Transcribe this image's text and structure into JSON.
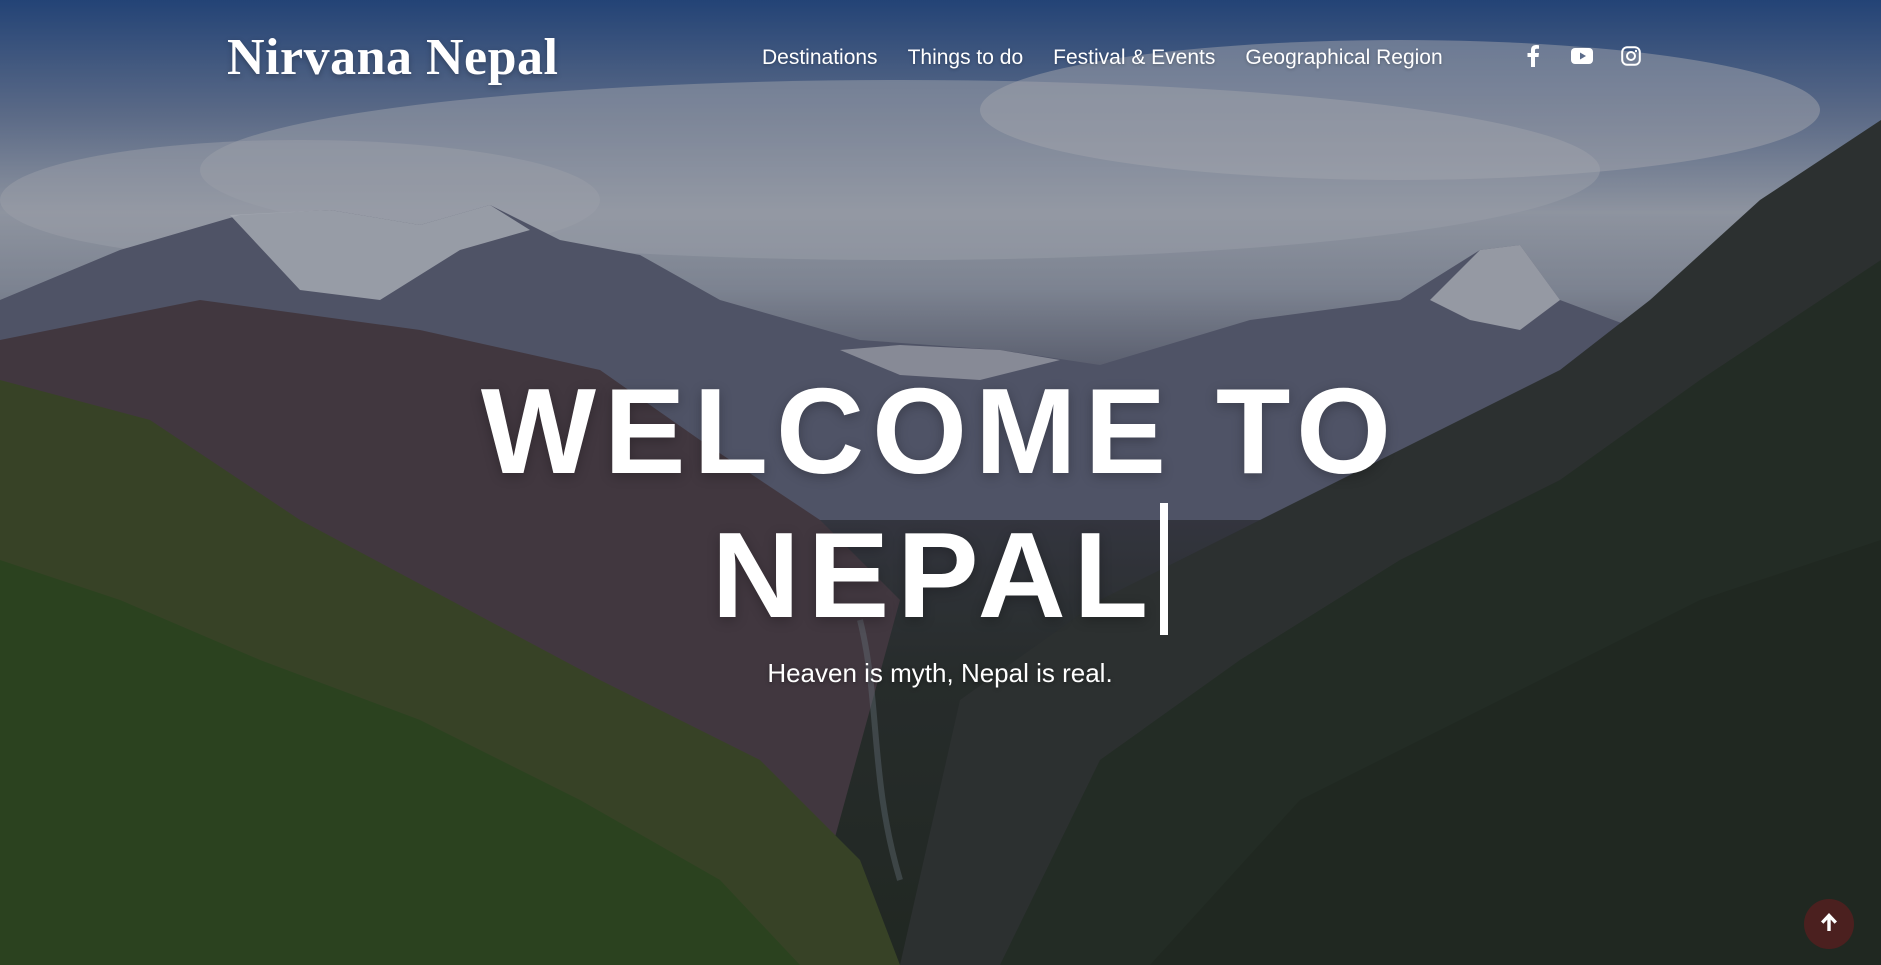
{
  "brand": {
    "name": "Nirvana Nepal"
  },
  "nav": {
    "items": [
      {
        "label": "Destinations"
      },
      {
        "label": "Things to do"
      },
      {
        "label": "Festival & Events"
      },
      {
        "label": "Geographical Region"
      }
    ]
  },
  "social": {
    "icons": [
      "facebook-icon",
      "youtube-icon",
      "instagram-icon"
    ]
  },
  "hero": {
    "headline_line1": "WELCOME TO",
    "headline_line2": "NEPAL",
    "tagline": "Heaven is myth, Nepal is real.",
    "background": "mountain-landscape-photo"
  },
  "scroll_top": {
    "icon": "arrow-up-icon"
  },
  "colors": {
    "text": "#ffffff",
    "sky": "#2f5b9e",
    "scroll_top_bg": "#561e1e"
  }
}
